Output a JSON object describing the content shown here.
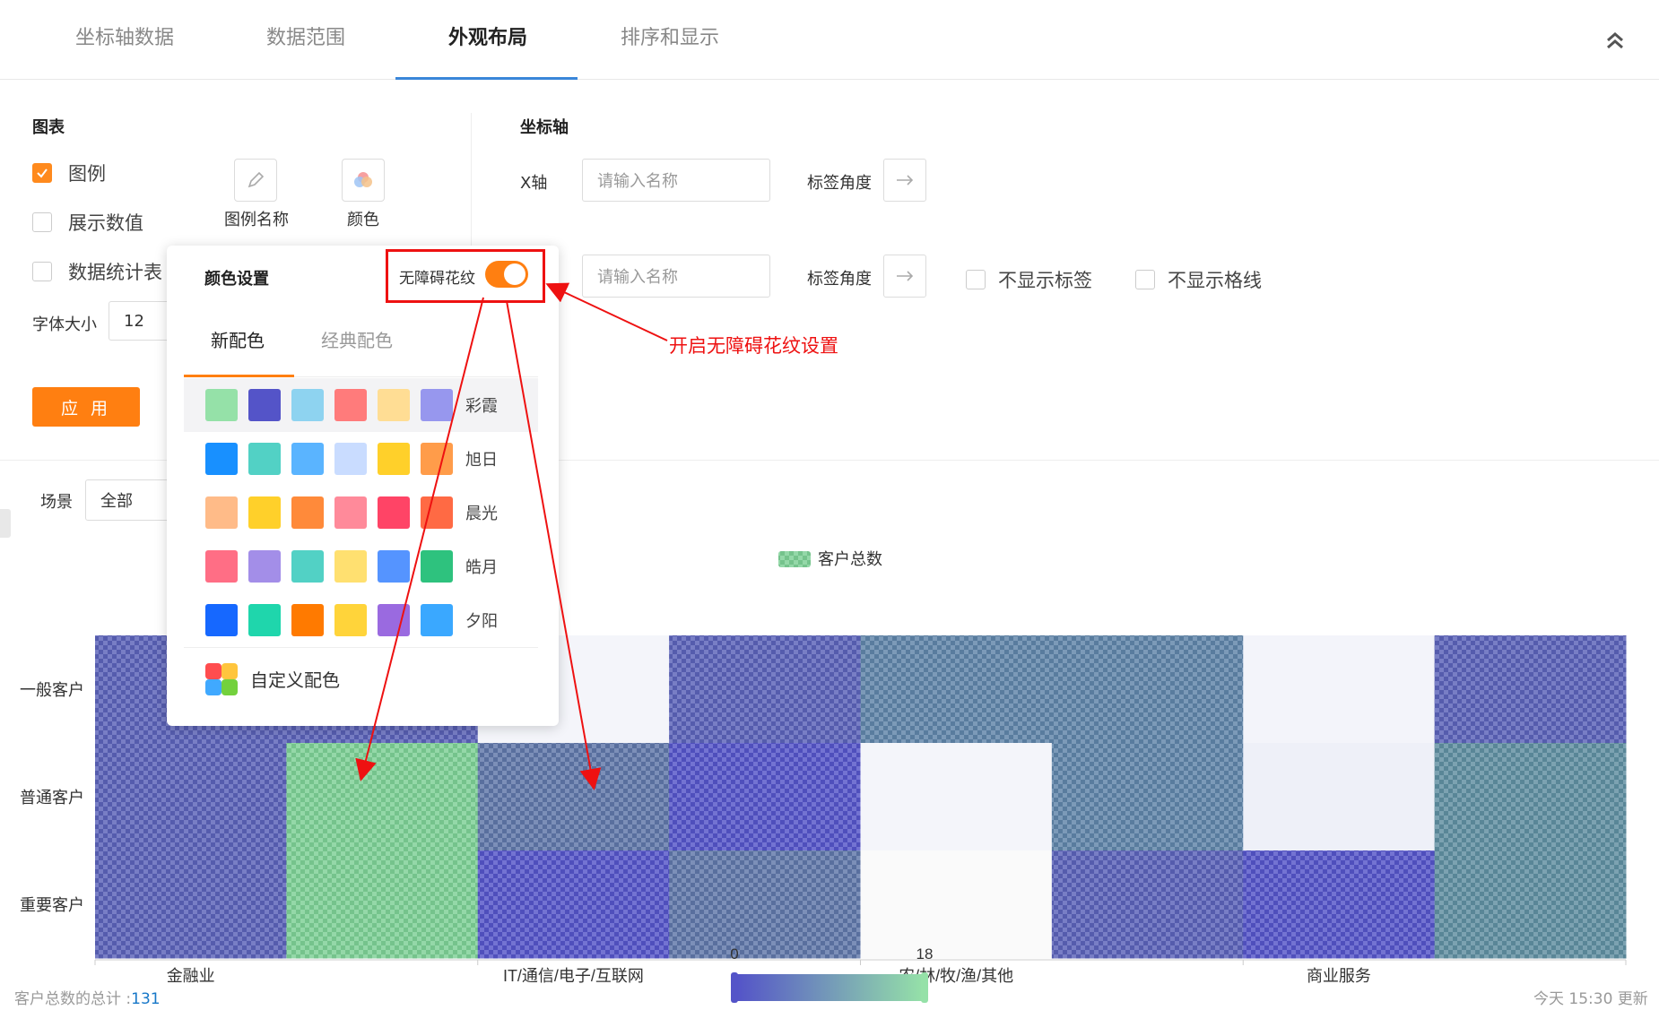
{
  "tabs": [
    {
      "label": "坐标轴数据",
      "active": false
    },
    {
      "label": "数据范围",
      "active": false
    },
    {
      "label": "外观布局",
      "active": true
    },
    {
      "label": "排序和显示",
      "active": false
    }
  ],
  "chart_panel": {
    "title": "图表",
    "legend_label": "图例",
    "show_values_label": "展示数值",
    "stats_table_label": "数据统计表",
    "font_size_label": "字体大小",
    "font_size_value": "12",
    "legend_name_caption": "图例名称",
    "color_caption": "颜色",
    "apply_label": "应 用"
  },
  "axis_panel": {
    "title": "坐标轴",
    "x_label": "X轴",
    "x_placeholder": "请输入名称",
    "y_placeholder": "请输入名称",
    "label_angle": "标签角度",
    "hide_labels": "不显示标签",
    "hide_gridlines": "不显示格线"
  },
  "color_popup": {
    "title": "颜色设置",
    "accessible_pattern_label": "无障碍花纹",
    "accessible_pattern_on": true,
    "tabs": [
      "新配色",
      "经典配色"
    ],
    "schemes": [
      {
        "name": "彩霞",
        "colors": [
          "#95e1a8",
          "#5454c8",
          "#8ed3f0",
          "#ff7b7b",
          "#ffdd94",
          "#9797ee"
        ]
      },
      {
        "name": "旭日",
        "colors": [
          "#1890ff",
          "#52d1c5",
          "#5ab4ff",
          "#c9dcff",
          "#ffd02a",
          "#ff9c4a"
        ]
      },
      {
        "name": "晨光",
        "colors": [
          "#ffbb88",
          "#ffd02a",
          "#ff8a3a",
          "#ff8a9a",
          "#ff4466",
          "#ff6a44"
        ]
      },
      {
        "name": "皓月",
        "colors": [
          "#ff6e85",
          "#a38ee8",
          "#52d1c5",
          "#ffe070",
          "#5594ff",
          "#2ec27e"
        ]
      },
      {
        "name": "夕阳",
        "colors": [
          "#1668ff",
          "#1fd6ac",
          "#ff7a00",
          "#ffd43a",
          "#9a6ae0",
          "#3aa8ff"
        ]
      }
    ],
    "custom_label": "自定义配色"
  },
  "annotation_text": "开启无障碍花纹设置",
  "scene": {
    "label": "场景",
    "value": "全部"
  },
  "legend_series": "客户总数",
  "chart_data": {
    "type": "heatmap",
    "x_ticks": [
      "金融业",
      "IT/通信/电子/互联网",
      "农/林/牧/渔/其他",
      "商业服务"
    ],
    "y": [
      "一般客户",
      "普通客户",
      "重要客户"
    ],
    "visualmap": {
      "min": "0",
      "max": "18",
      "colors": [
        "#5454c8",
        "#95e1a8"
      ]
    },
    "cells": [
      [
        "#5a62b8",
        "#5a62b8",
        "#f4f5fa",
        "#5a62b8",
        "#5f84a8",
        "#5f84a8",
        "#f3f4fa",
        "#5a62b8"
      ],
      [
        "#5a62b8",
        "#7ccf95",
        "#5f76a8",
        "#5454c8",
        "#f4f5fa",
        "#5f84a8",
        "#eef0f8",
        "#5f8ea0"
      ],
      [
        "#5a62b8",
        "#7ccf95",
        "#5454c8",
        "#5f76a8",
        "#fafafa",
        "#5a62b8",
        "#5454c8",
        "#5f8ea0"
      ]
    ],
    "colors": {
      "primary": "#ff7f11",
      "link": "#1677c8"
    }
  },
  "footer": {
    "total_label": "客户总数的总计 :",
    "total_value": "131",
    "updated": "今天 15:30 更新"
  }
}
